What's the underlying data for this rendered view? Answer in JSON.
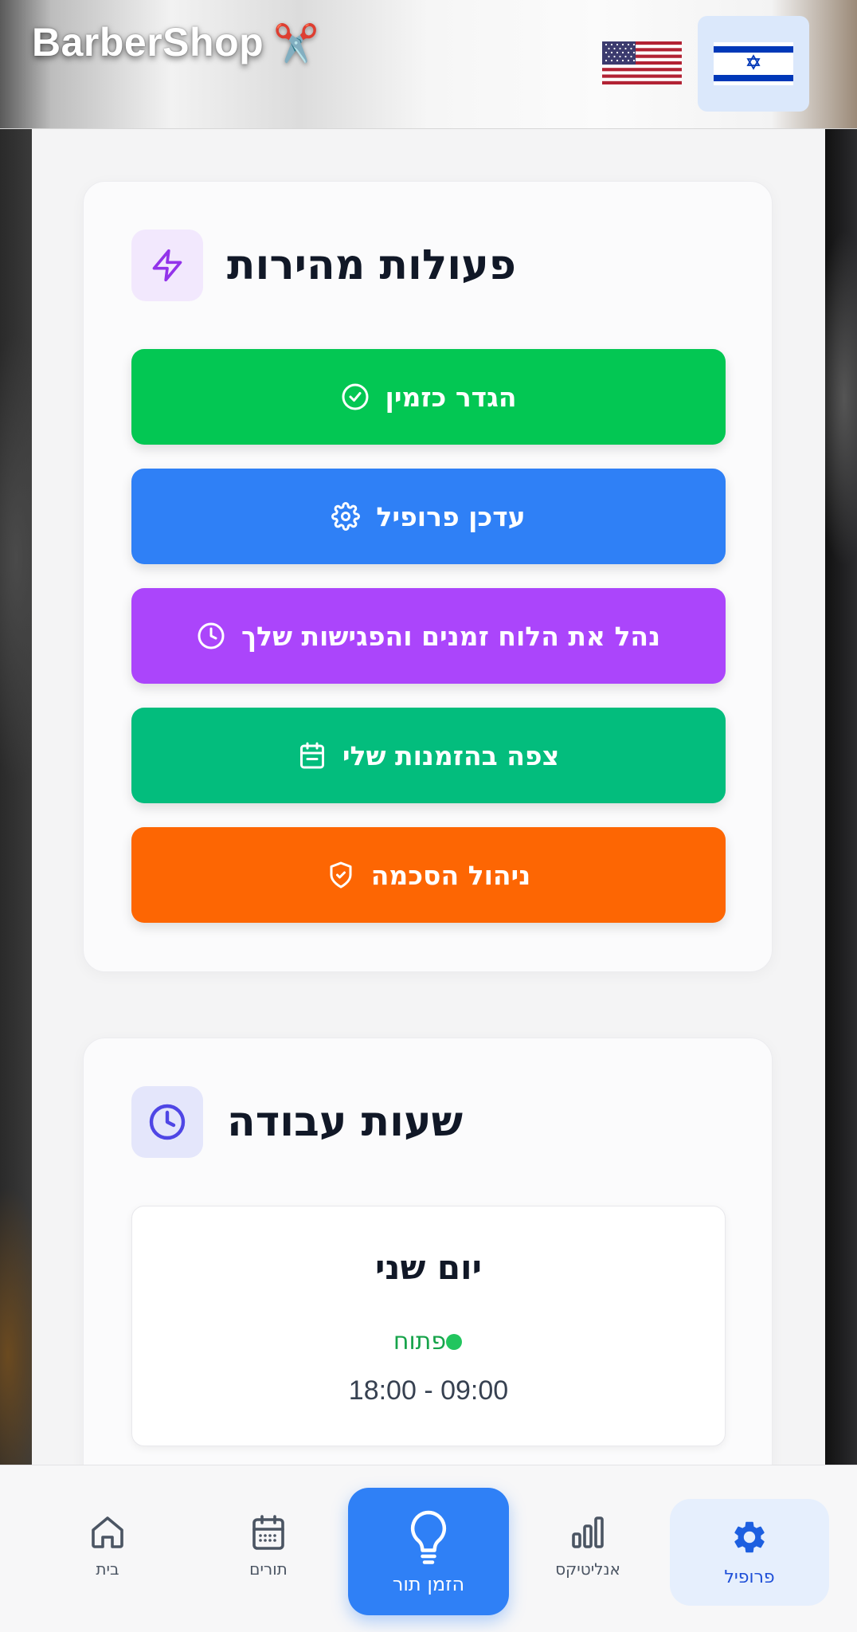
{
  "header": {
    "brand": "BarberShop",
    "brand_emoji": "✂️",
    "flags": [
      {
        "name": "us-flag",
        "label": "English"
      },
      {
        "name": "israel-flag",
        "label": "עברית",
        "selected": true
      }
    ]
  },
  "quick_actions": {
    "title": "פעולות מהירות",
    "icon": "lightning-icon",
    "buttons": [
      {
        "label": "הגדר כזמין",
        "icon": "check-circle-icon",
        "color": "#03c753"
      },
      {
        "label": "עדכן פרופיל",
        "icon": "gear-icon",
        "color": "#2f80f6"
      },
      {
        "label": "נהל את הלוח זמנים והפגישות שלך",
        "icon": "clock-icon",
        "color": "#ab45fb"
      },
      {
        "label": "צפה בהזמנות שלי",
        "icon": "calendar-icon",
        "color": "#03bd7d"
      },
      {
        "label": "ניהול הסכמה",
        "icon": "shield-check-icon",
        "color": "#fd6603"
      }
    ]
  },
  "working_hours": {
    "title": "שעות עבודה",
    "icon": "clock-icon",
    "days": [
      {
        "name": "יום שני",
        "status": "פתוח",
        "status_color": "#16a34a",
        "hours": "18:00 - 09:00"
      }
    ]
  },
  "bottom_nav": {
    "items": [
      {
        "label": "בית",
        "icon": "home-icon"
      },
      {
        "label": "תורים",
        "icon": "calendar-icon"
      },
      {
        "label": "הזמן תור",
        "icon": "lightbulb-icon",
        "primary": true
      },
      {
        "label": "אנליטיקס",
        "icon": "bar-chart-icon"
      },
      {
        "label": "פרופיל",
        "icon": "gear-icon",
        "active": true
      }
    ]
  }
}
